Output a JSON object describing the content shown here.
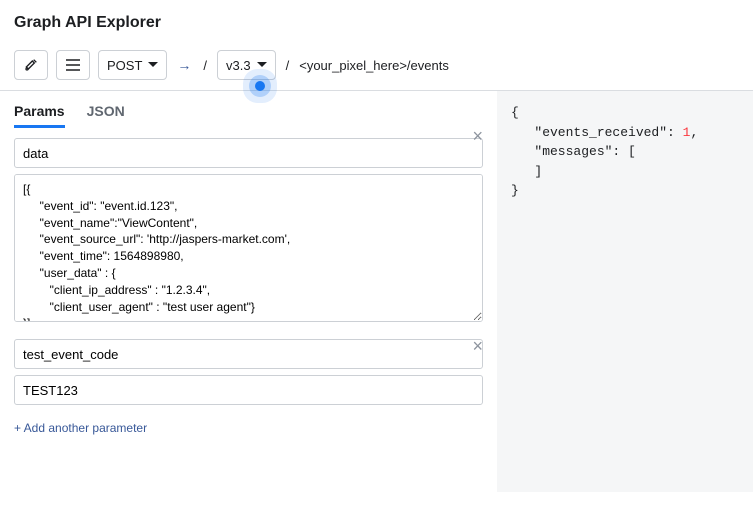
{
  "header": {
    "title": "Graph API Explorer"
  },
  "toolbar": {
    "method": "POST",
    "version": "v3.3",
    "path": "<your_pixel_here>/events"
  },
  "tabs": {
    "params": "Params",
    "json": "JSON"
  },
  "params": {
    "field1_name": "data",
    "field1_value": "[{\n     \"event_id\": \"event.id.123\",\n     \"event_name\":\"ViewContent\",\n     \"event_source_url\": 'http://jaspers-market.com',\n     \"event_time\": 1564898980,\n     \"user_data\" : {\n        \"client_ip_address\" : \"1.2.3.4\",\n        \"client_user_agent\" : \"test user agent\"}\n}]",
    "field2_name": "test_event_code",
    "field2_value": "TEST123",
    "add_link": "+ Add another parameter"
  },
  "response": {
    "key1": "\"events_received\"",
    "val1": "1",
    "key2": "\"messages\"",
    "brace_open": "{",
    "brace_close": "}",
    "bracket_open": "[",
    "bracket_close": "]",
    "colon": ": ",
    "comma": ","
  }
}
